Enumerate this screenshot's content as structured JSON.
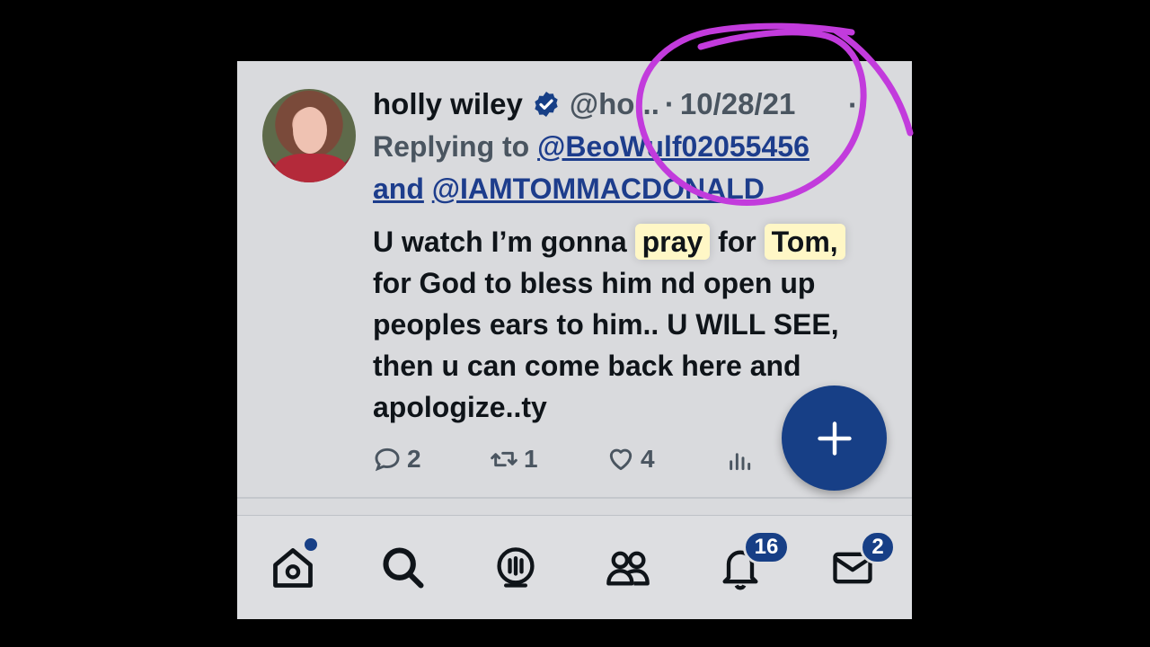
{
  "tweet": {
    "author_name": "holly wiley",
    "author_handle": "@ho...",
    "separator": "·",
    "date": "10/28/21",
    "more_label": "·",
    "replying_prefix": "Replying to",
    "reply_user1": "@BeoWulf02055456",
    "reply_and": "and",
    "reply_user2": "@IAMTOMMACDONALD",
    "text_part1": "U watch I’m gonna",
    "highlight1": "pray",
    "text_part2": "for",
    "highlight2": "Tom,",
    "text_line2": "for God to bless him nd open up",
    "text_line3": "peoples ears to  him.. U WILL SEE,",
    "text_line4": "then u can come back here and",
    "text_line5": "apologize..ty"
  },
  "actions": {
    "replies": "2",
    "retweets": "1",
    "likes": "4"
  },
  "tabbar": {
    "notifications_badge": "16",
    "messages_badge": "2"
  },
  "colors": {
    "accent": "#173f86",
    "highlight": "#fff7c6",
    "annotation": "#c23bdc"
  },
  "icons": [
    "verified-icon",
    "reply-icon",
    "retweet-icon",
    "like-icon",
    "views-icon",
    "plus-icon",
    "home-icon",
    "search-icon",
    "spaces-icon",
    "communities-icon",
    "bell-icon",
    "mail-icon"
  ]
}
